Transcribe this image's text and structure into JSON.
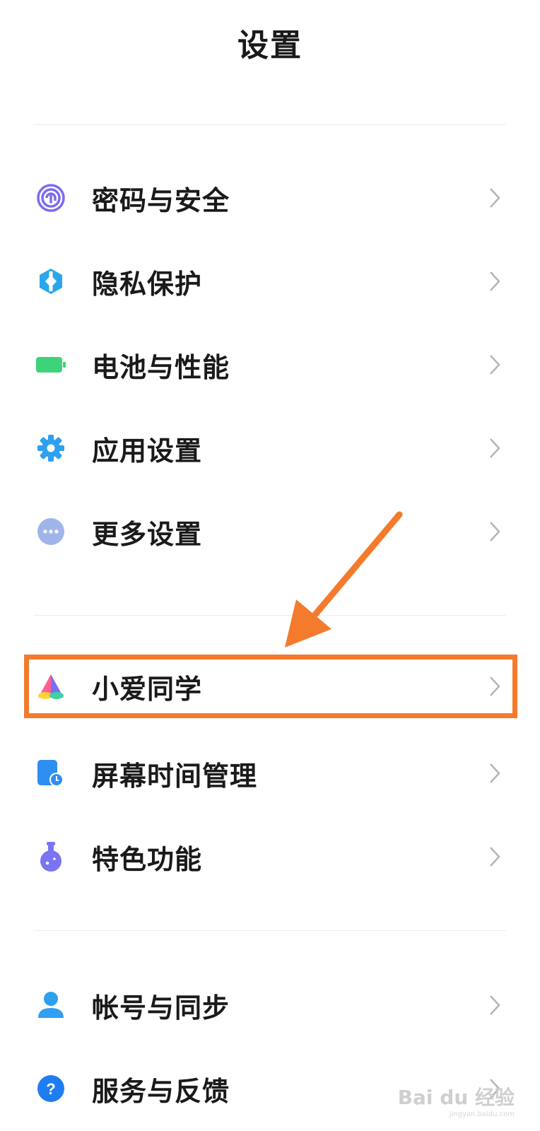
{
  "header": {
    "title": "设置"
  },
  "groups": [
    {
      "items": [
        {
          "label": "密码与安全",
          "icon": "fingerprint-icon"
        },
        {
          "label": "隐私保护",
          "icon": "privacy-shield-icon"
        },
        {
          "label": "电池与性能",
          "icon": "battery-icon"
        },
        {
          "label": "应用设置",
          "icon": "gear-icon"
        },
        {
          "label": "更多设置",
          "icon": "more-dots-icon"
        }
      ]
    },
    {
      "items": [
        {
          "label": "小爱同学",
          "icon": "xiaoai-assistant-icon"
        },
        {
          "label": "屏幕时间管理",
          "icon": "screen-time-icon"
        },
        {
          "label": "特色功能",
          "icon": "flask-icon"
        }
      ]
    },
    {
      "items": [
        {
          "label": "帐号与同步",
          "icon": "account-icon"
        },
        {
          "label": "服务与反馈",
          "icon": "help-icon"
        }
      ]
    }
  ],
  "annotation": {
    "highlighted_item": "小爱同学",
    "color": "#f47a2c"
  },
  "watermark": {
    "text": "Bai du 经验",
    "sub": "jingyan.baidu.com"
  },
  "colors": {
    "fingerprint": "#7b6cf0",
    "privacy": "#2aa7ea",
    "battery": "#3ed27a",
    "gear": "#2f9ff0",
    "more": "#9fb5ea",
    "screen_time": "#2f8ff0",
    "flask": "#7a74f2",
    "account": "#2f9ff0",
    "help": "#1f7df0"
  }
}
